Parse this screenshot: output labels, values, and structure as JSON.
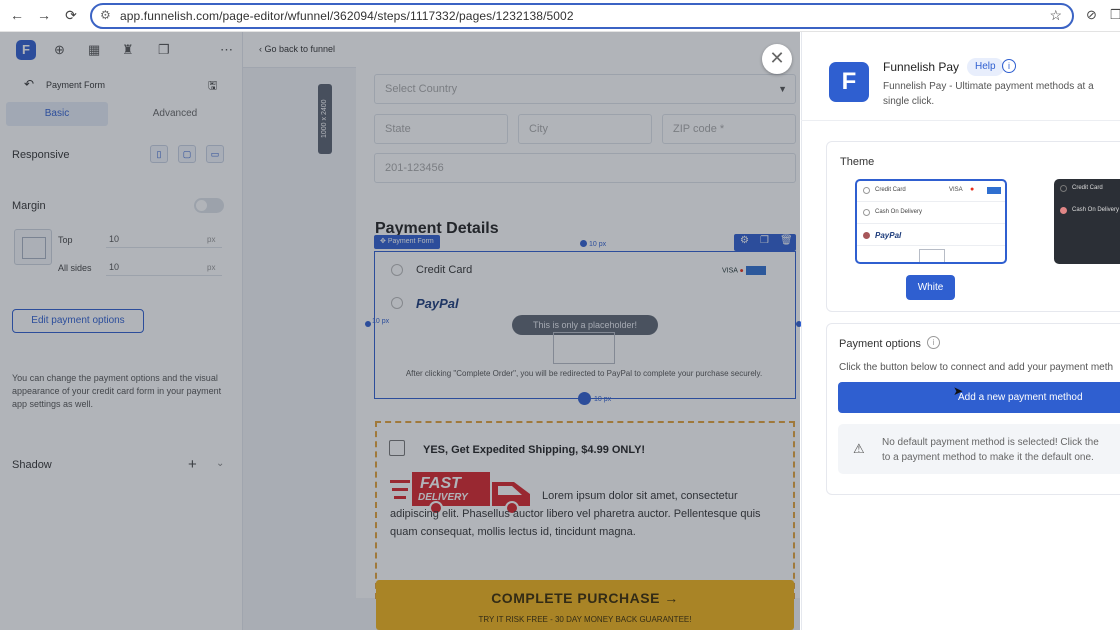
{
  "browser": {
    "url": "app.funnelish.com/page-editor/wfunnel/362094/steps/1117332/pages/1232138/5002"
  },
  "left_panel": {
    "title": "Payment Form",
    "tabs": [
      "Basic",
      "Advanced"
    ],
    "responsive_label": "Responsive",
    "margin_label": "Margin",
    "top_label": "Top",
    "top_value": "10",
    "all_sides_label": "All sides",
    "all_sides_value": "10",
    "unit": "px",
    "edit_button": "Edit payment options",
    "help_text": "You can change the payment options and the visual appearance of your credit card form in your payment app settings as well.",
    "shadow_label": "Shadow"
  },
  "canvas_nav": {
    "back_label": "Go back to funnel"
  },
  "page": {
    "vertical_badge": "1000 x 2400",
    "select_country": "Select Country",
    "state": "State",
    "city": "City",
    "zip": "ZIP code *",
    "phone": "201-123456",
    "payment_details": "Payment Details",
    "payment_form_tag": "Payment Form",
    "margin_top": "10 px",
    "margin_left": "10 px",
    "margin_bottom": "10 px",
    "credit_card": "Credit Card",
    "card_brands": "VISA",
    "paypal": "PayPal",
    "placeholder": "This is only a placeholder!",
    "paypal_note": "After clicking \"Complete Order\", you will be redirected to PayPal to complete your purchase securely.",
    "upsell_title": "YES, Get Expedited Shipping, $4.99 ONLY!",
    "fast_top": "FAST",
    "fast_bottom": "DELIVERY",
    "lorem": "Lorem ipsum dolor sit amet, consectetur adipiscing elit. Phasellus auctor libero vel pharetra auctor. Pellentesque quis quam consequat, mollis lectus id, tincidunt magna.",
    "cta": "COMPLETE PURCHASE →",
    "cta_sub": "TRY IT RISK FREE - 30 DAY MONEY BACK GUARANTEE!"
  },
  "modal": {
    "logo": "F",
    "title": "Funnelish Pay",
    "help": "Help",
    "description": "Funnelish Pay - Ultimate payment methods at a single click.",
    "theme_label": "Theme",
    "theme_rows": [
      "Credit Card",
      "Cash On Delivery",
      "PayPal"
    ],
    "theme_dark_rows": [
      "Credit Card",
      "Cash On Delivery"
    ],
    "theme_visa": "VISA",
    "white_button": "White",
    "payment_options_label": "Payment options",
    "payment_options_desc": "Click the button below to connect and add your payment meth",
    "add_button": "Add a new payment method",
    "warning_line1": "No default payment method is selected! Click the",
    "warning_line2": "to a payment method to make it the default one."
  },
  "colors": {
    "accent": "#2f5fd0",
    "cta": "#f3b519",
    "upsell_border": "#e4a33a",
    "fast_red": "#d9242b"
  }
}
